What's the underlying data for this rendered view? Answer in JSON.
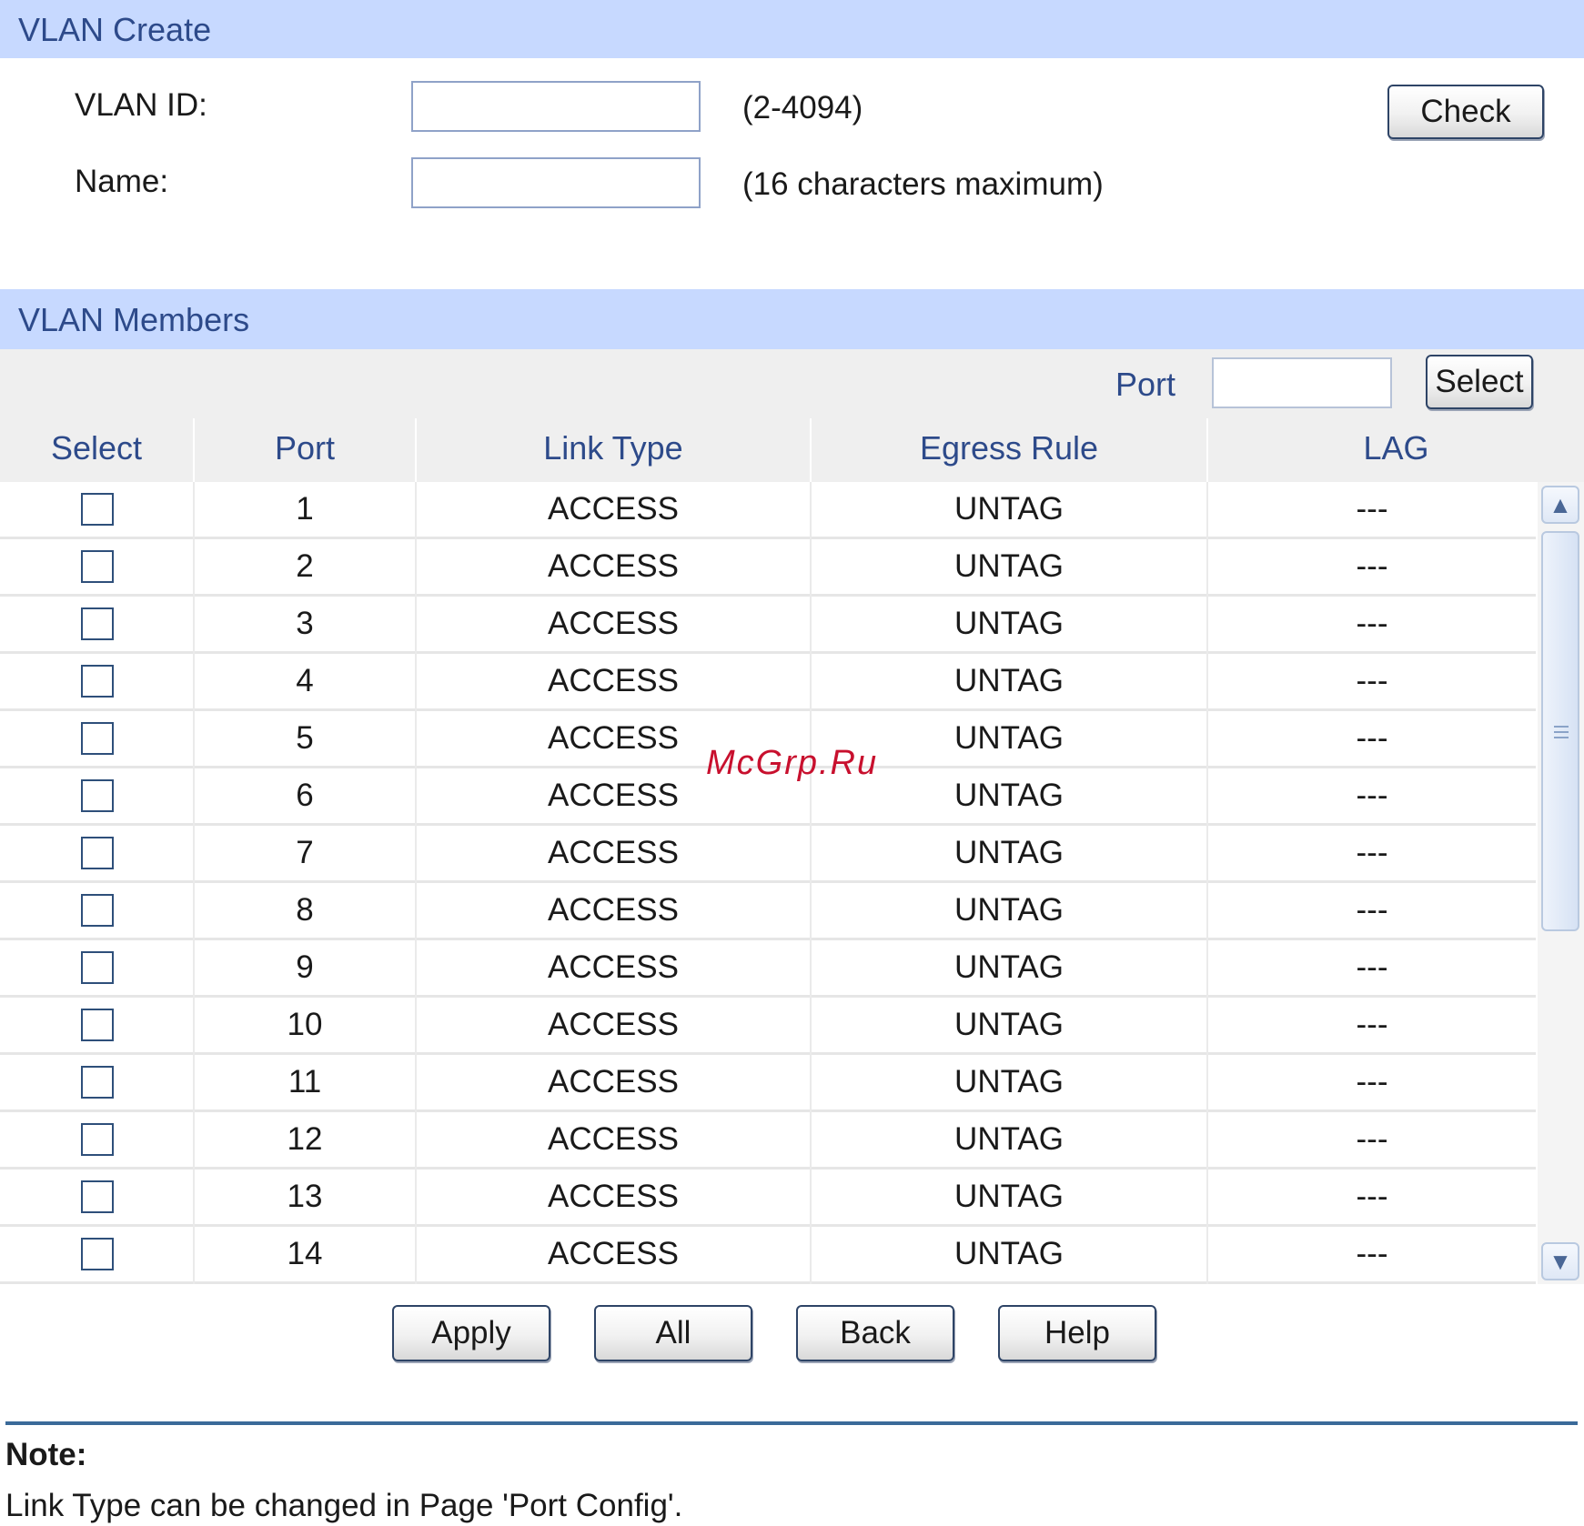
{
  "vlan_create": {
    "title": "VLAN Create",
    "vlan_id_label": "VLAN ID:",
    "vlan_id_value": "",
    "vlan_id_hint": "(2-4094)",
    "name_label": "Name:",
    "name_value": "",
    "name_hint": "(16 characters maximum)",
    "check_button": "Check"
  },
  "vlan_members": {
    "title": "VLAN Members",
    "port_filter_label": "Port",
    "port_filter_value": "",
    "select_button": "Select",
    "columns": {
      "select": "Select",
      "port": "Port",
      "link_type": "Link Type",
      "egress_rule": "Egress Rule",
      "lag": "LAG"
    },
    "rows": [
      {
        "port": "1",
        "link_type": "ACCESS",
        "egress_rule": "UNTAG",
        "lag": "---"
      },
      {
        "port": "2",
        "link_type": "ACCESS",
        "egress_rule": "UNTAG",
        "lag": "---"
      },
      {
        "port": "3",
        "link_type": "ACCESS",
        "egress_rule": "UNTAG",
        "lag": "---"
      },
      {
        "port": "4",
        "link_type": "ACCESS",
        "egress_rule": "UNTAG",
        "lag": "---"
      },
      {
        "port": "5",
        "link_type": "ACCESS",
        "egress_rule": "UNTAG",
        "lag": "---"
      },
      {
        "port": "6",
        "link_type": "ACCESS",
        "egress_rule": "UNTAG",
        "lag": "---"
      },
      {
        "port": "7",
        "link_type": "ACCESS",
        "egress_rule": "UNTAG",
        "lag": "---"
      },
      {
        "port": "8",
        "link_type": "ACCESS",
        "egress_rule": "UNTAG",
        "lag": "---"
      },
      {
        "port": "9",
        "link_type": "ACCESS",
        "egress_rule": "UNTAG",
        "lag": "---"
      },
      {
        "port": "10",
        "link_type": "ACCESS",
        "egress_rule": "UNTAG",
        "lag": "---"
      },
      {
        "port": "11",
        "link_type": "ACCESS",
        "egress_rule": "UNTAG",
        "lag": "---"
      },
      {
        "port": "12",
        "link_type": "ACCESS",
        "egress_rule": "UNTAG",
        "lag": "---"
      },
      {
        "port": "13",
        "link_type": "ACCESS",
        "egress_rule": "UNTAG",
        "lag": "---"
      },
      {
        "port": "14",
        "link_type": "ACCESS",
        "egress_rule": "UNTAG",
        "lag": "---"
      }
    ]
  },
  "actions": {
    "apply": "Apply",
    "all": "All",
    "back": "Back",
    "help": "Help"
  },
  "note": {
    "title": "Note:",
    "text": "Link Type can be changed in Page 'Port Config'."
  },
  "watermark": "McGrp.Ru",
  "icons": {
    "scroll_up": "chevron-up-icon",
    "scroll_down": "chevron-down-icon"
  },
  "colors": {
    "section_header_bg": "#c7d9ff",
    "header_text": "#2d4a8a",
    "divider": "#3a6a99",
    "watermark": "#c8102e"
  }
}
